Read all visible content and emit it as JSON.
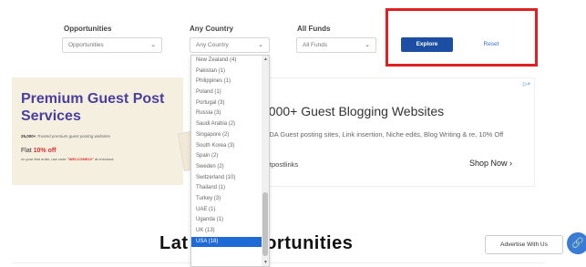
{
  "filters": {
    "opportunities_label": "Opportunities",
    "opportunities_value": "Opportunities",
    "country_label": "Any Country",
    "country_value": "Any Country",
    "funds_label": "All Funds",
    "funds_value": "All Funds",
    "explore_label": "Explore",
    "reset_label": "Reset"
  },
  "country_options": [
    {
      "label": "New Zealand  (4)"
    },
    {
      "label": "Pakistan  (1)"
    },
    {
      "label": "Philippines  (1)"
    },
    {
      "label": "Poland  (1)"
    },
    {
      "label": "Portugal  (3)"
    },
    {
      "label": "Russia  (3)"
    },
    {
      "label": "Saudi Arabia  (2)"
    },
    {
      "label": "Singapore  (2)"
    },
    {
      "label": "South Korea  (3)"
    },
    {
      "label": "Spain  (2)"
    },
    {
      "label": "Sweden  (2)"
    },
    {
      "label": "Switzerland  (10)"
    },
    {
      "label": "Thailand  (1)"
    },
    {
      "label": "Turkey  (3)"
    },
    {
      "label": "UAE  (1)"
    },
    {
      "label": "Uganda  (1)"
    },
    {
      "label": "UK  (13)"
    },
    {
      "label": "USA  (18)"
    }
  ],
  "selected_option_index": 17,
  "ad_left": {
    "title": "Premium Guest Post Services",
    "sub_bold": "25,000+",
    "sub_rest": " Trusted premium guest posting websites",
    "flat_text": "Flat ",
    "flat_bold": "10% off",
    "code_pre": "on your first order, use code ",
    "code_bold": "\"WELCOME10\"",
    "code_post": " at checkout."
  },
  "ad_right": {
    "headline": "5000+ Guest Blogging Websites",
    "desc": "th DA Guest posting sites, Link insertion, Niche edits, Blog Writing & re, 10% Off",
    "brand": "estpostlinks",
    "shop": "Shop Now",
    "shop_icon": "chevron-right-icon",
    "adchoices": "▷×"
  },
  "section_title_left": "Lat",
  "section_title_right": "portunities",
  "advertise_label": "Advertise With Us",
  "link_icon": "link-icon",
  "colors": {
    "primary": "#1c4fa3",
    "highlight": "#e02020",
    "selected": "#1e6ad6",
    "ad_title": "#4a3fa0"
  }
}
